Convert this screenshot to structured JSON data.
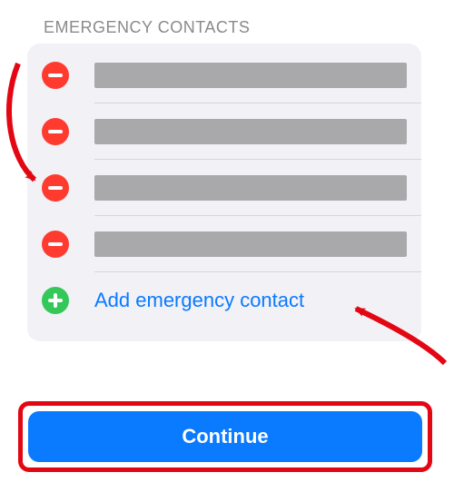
{
  "section": {
    "header": "EMERGENCY CONTACTS"
  },
  "rows": {
    "add_label": "Add emergency contact"
  },
  "continue_label": "Continue",
  "colors": {
    "delete": "#ff3b30",
    "add": "#34c759",
    "link": "#0a7aff",
    "primary": "#0a7aff",
    "annotation": "#e30613"
  }
}
